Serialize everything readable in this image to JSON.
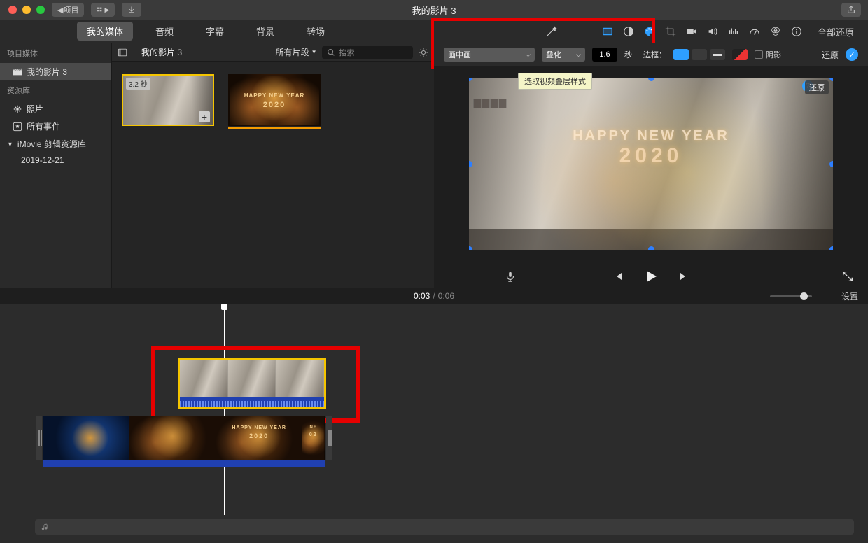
{
  "titlebar": {
    "project_button": "项目",
    "title": "我的影片 3"
  },
  "tabs": {
    "media": "我的媒体",
    "audio": "音频",
    "titles": "字幕",
    "backgrounds": "背景",
    "transitions": "转场"
  },
  "adjust": {
    "restore_all": "全部还原"
  },
  "sidebar": {
    "section_project": "项目媒体",
    "project_name": "我的影片 3",
    "section_library": "资源库",
    "photos": "照片",
    "all_events": "所有事件",
    "imovie_lib": "iMovie 剪辑资源库",
    "event_date": "2019-12-21"
  },
  "browser": {
    "title": "我的影片 3",
    "filter": "所有片段",
    "search_placeholder": "搜索",
    "thumb1_duration": "3.2 秒"
  },
  "overlay": {
    "mode": "画中画",
    "dissolve": "叠化",
    "duration": "1.6",
    "seconds": "秒",
    "border_label": "边框：",
    "shadow_label": "阴影",
    "restore": "还原",
    "tooltip": "选取视频叠层样式",
    "badge_restore": "还原"
  },
  "preview": {
    "line1": "HAPPY NEW YEAR",
    "line2": "2020"
  },
  "timecode": {
    "current": "0:03",
    "total": "0:06",
    "settings": "设置"
  },
  "timeline": {
    "ny_text1": "HAPPY NEW YEAR",
    "ny_text2": "2020",
    "ny_text3": "NE",
    "ny_text4": "02"
  }
}
